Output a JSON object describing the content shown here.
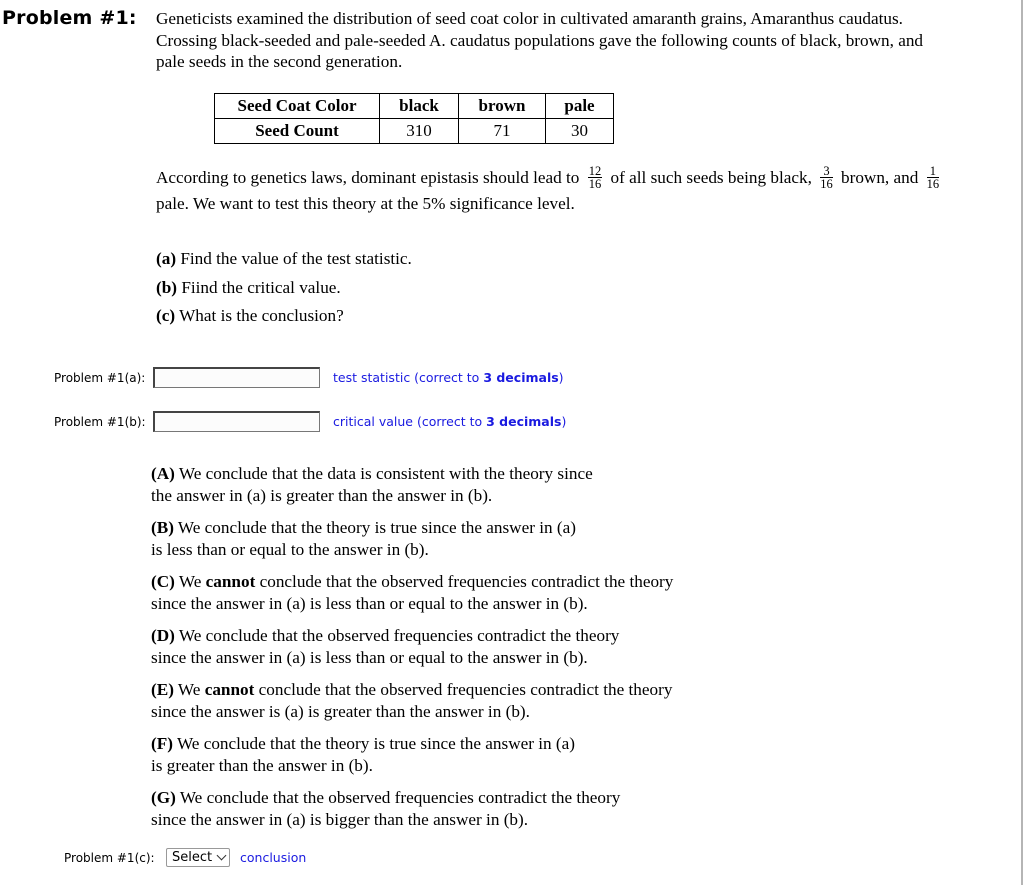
{
  "problem": {
    "title": "Problem #1:",
    "intro_lines": [
      "Geneticists examined the distribution of seed coat color in cultivated amaranth grains, Amaranthus caudatus.",
      "Crossing black-seeded and pale-seeded A. caudatus populations gave the following counts of black, brown, and",
      "pale seeds in the second generation."
    ],
    "table": {
      "header": [
        "Seed Coat Color",
        "black",
        "brown",
        "pale"
      ],
      "row": [
        "Seed Count",
        "310",
        "71",
        "30"
      ]
    },
    "theory": {
      "text_1": "According to genetics laws, dominant epistasis should lead to",
      "frac_black": {
        "num": "12",
        "den": "16"
      },
      "text_2": "of all such seeds being black,",
      "frac_brown": {
        "num": "3",
        "den": "16"
      },
      "text_3": "brown, and",
      "frac_pale": {
        "num": "1",
        "den": "16"
      },
      "line_2": "pale. We want to test this theory at the 5% significance level."
    },
    "parts": [
      {
        "label": "(a)",
        "text": "Find the value of the test statistic."
      },
      {
        "label": "(b)",
        "text": "Fiind the critical value."
      },
      {
        "label": "(c)",
        "text": "What is the conclusion?"
      }
    ]
  },
  "answers": {
    "a": {
      "label": "Problem #1(a):",
      "value": "",
      "hint_prefix": "test statistic (correct to ",
      "hint_bold": "3 decimals",
      "hint_suffix": ")"
    },
    "b": {
      "label": "Problem #1(b):",
      "value": "",
      "hint_prefix": "critical value (correct to ",
      "hint_bold": "3 decimals",
      "hint_suffix": ")"
    },
    "c": {
      "label": "Problem #1(c):",
      "select_value": "Select",
      "hint": "conclusion"
    }
  },
  "options": [
    {
      "key": "(A)",
      "pre": " We conclude that the data is consistent with the theory since",
      "bold": "",
      "post": "",
      "line2": "the answer in (a) is greater than the answer in (b)."
    },
    {
      "key": "(B)",
      "pre": " We conclude that the theory is true since the answer in (a)",
      "bold": "",
      "post": "",
      "line2": "is less than or equal to the answer in (b)."
    },
    {
      "key": "(C)",
      "pre": " We ",
      "bold": "cannot",
      "post": " conclude that the observed frequencies contradict the theory",
      "line2": "since the answer in (a) is less than or equal to the answer in (b)."
    },
    {
      "key": "(D)",
      "pre": " We conclude that the observed frequencies contradict the theory",
      "bold": "",
      "post": "",
      "line2": "since the answer in (a) is less than or equal to the answer in (b)."
    },
    {
      "key": "(E)",
      "pre": " We ",
      "bold": "cannot",
      "post": " conclude that the observed frequencies contradict the theory",
      "line2": "since the answer is (a) is greater than the answer in (b)."
    },
    {
      "key": "(F)",
      "pre": " We conclude that the theory is true since the answer in (a)",
      "bold": "",
      "post": "",
      "line2": "is greater than the answer in (b)."
    },
    {
      "key": "(G)",
      "pre": " We conclude that the observed frequencies contradict the theory",
      "bold": "",
      "post": "",
      "line2": "since the answer in (a) is bigger than the answer in (b)."
    }
  ]
}
